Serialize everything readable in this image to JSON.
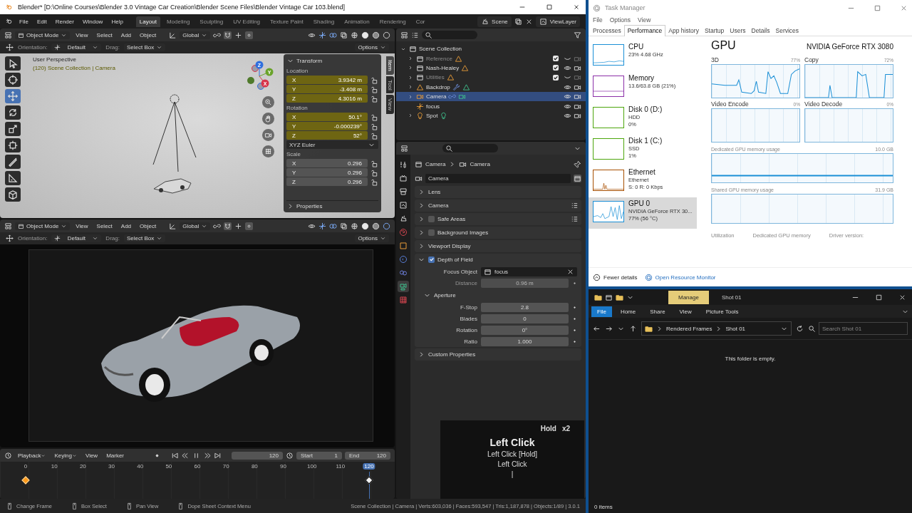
{
  "blender": {
    "title": "Blender* [D:\\Online Courses\\Blender 3.0 Vintage Car Creation\\Blender Scene Files\\Blender Vintage Car 103.blend]",
    "menus": [
      "File",
      "Edit",
      "Render",
      "Window",
      "Help"
    ],
    "workspaces": [
      {
        "label": "Layout",
        "selected": true
      },
      {
        "label": "Modeling",
        "selected": false
      },
      {
        "label": "Sculpting",
        "selected": false
      },
      {
        "label": "UV Editing",
        "selected": false
      },
      {
        "label": "Texture Paint",
        "selected": false
      },
      {
        "label": "Shading",
        "selected": false
      },
      {
        "label": "Animation",
        "selected": false
      },
      {
        "label": "Rendering",
        "selected": false
      },
      {
        "label": "Cor",
        "selected": false
      }
    ],
    "viewports": [
      {
        "kind": "solid",
        "header": {
          "mode": "Object Mode",
          "menus": [
            "View",
            "Select",
            "Add",
            "Object"
          ],
          "orientation": "Global"
        },
        "tool_header": {
          "orientation_label": "Orientation:",
          "orientation": "Default",
          "drag_label": "Drag:",
          "drag": "Select Box",
          "options": "Options"
        },
        "tools": [
          {
            "kind": "select",
            "selected": false
          },
          {
            "kind": "cursor",
            "selected": false
          },
          {
            "kind": "move",
            "selected": true
          },
          {
            "kind": "rotate",
            "selected": false
          },
          {
            "kind": "scale",
            "selected": false
          },
          {
            "kind": "transform",
            "selected": false
          },
          {
            "kind": "annotate",
            "selected": false
          },
          {
            "kind": "measure",
            "selected": false
          },
          {
            "kind": "add_cube",
            "selected": false
          }
        ],
        "overlay": {
          "perspective": "User Perspective",
          "collection": "(120) Scene Collection | Camera"
        },
        "axes": [
          {
            "label": "Z",
            "color": "#2f6fde"
          },
          {
            "label": "Y",
            "color": "#6aa32a"
          },
          {
            "label": "X",
            "color": "#d8344a"
          }
        ],
        "sidebar": {
          "tabs": [
            {
              "label": "Item",
              "selected": true
            },
            {
              "label": "Tool",
              "selected": false
            },
            {
              "label": "View",
              "selected": false
            }
          ],
          "panel": "Transform",
          "groups": [
            {
              "label": "Location",
              "fields": [
                {
                  "axis": "X",
                  "value": "3.9342 m",
                  "keyed": true
                },
                {
                  "axis": "Y",
                  "value": "-3.408 m",
                  "keyed": true
                },
                {
                  "axis": "Z",
                  "value": "4.3016 m",
                  "keyed": true
                }
              ]
            },
            {
              "label": "Rotation",
              "fields": [
                {
                  "axis": "X",
                  "value": "50.1°",
                  "keyed": true
                },
                {
                  "axis": "Y",
                  "value": "-0.000239°",
                  "keyed": true
                },
                {
                  "axis": "Z",
                  "value": "52°",
                  "keyed": true
                }
              ],
              "dropdown": "XYZ Euler"
            },
            {
              "label": "Scale",
              "fields": [
                {
                  "axis": "X",
                  "value": "0.296",
                  "keyed": false
                },
                {
                  "axis": "Y",
                  "value": "0.296",
                  "keyed": false
                },
                {
                  "axis": "Z",
                  "value": "0.296",
                  "keyed": false
                }
              ]
            }
          ],
          "collapsed_panel": "Properties"
        }
      },
      {
        "kind": "camera",
        "header": {
          "mode": "Object Mode",
          "menus": [
            "View",
            "Select",
            "Add",
            "Object"
          ],
          "orientation": "Global"
        },
        "tool_header": {
          "orientation_label": "Orientation:",
          "orientation": "Default",
          "drag_label": "Drag:",
          "drag": "Select Box",
          "options": "Options"
        }
      }
    ],
    "timeline": {
      "menus": [
        "Playback",
        "Keying",
        "View",
        "Marker"
      ],
      "frame": "120",
      "start_label": "Start",
      "start": "1",
      "end_label": "End",
      "end": "120",
      "ticks": [
        {
          "label": "0",
          "selected": false,
          "keyframe": true,
          "keyframe_selected": true
        },
        {
          "label": "10",
          "selected": false,
          "keyframe": false,
          "keyframe_selected": false
        },
        {
          "label": "20",
          "selected": false,
          "keyframe": false,
          "keyframe_selected": false
        },
        {
          "label": "30",
          "selected": false,
          "keyframe": false,
          "keyframe_selected": false
        },
        {
          "label": "40",
          "selected": false,
          "keyframe": false,
          "keyframe_selected": false
        },
        {
          "label": "50",
          "selected": false,
          "keyframe": false,
          "keyframe_selected": false
        },
        {
          "label": "60",
          "selected": false,
          "keyframe": false,
          "keyframe_selected": false
        },
        {
          "label": "70",
          "selected": false,
          "keyframe": false,
          "keyframe_selected": false
        },
        {
          "label": "80",
          "selected": false,
          "keyframe": false,
          "keyframe_selected": false
        },
        {
          "label": "90",
          "selected": false,
          "keyframe": false,
          "keyframe_selected": false
        },
        {
          "label": "100",
          "selected": false,
          "keyframe": false,
          "keyframe_selected": false
        },
        {
          "label": "110",
          "selected": false,
          "keyframe": false,
          "keyframe_selected": false
        },
        {
          "label": "120",
          "selected": true,
          "keyframe": true,
          "keyframe_selected": false
        }
      ]
    },
    "outliner": {
      "title": "Scene",
      "view_layer": "ViewLayer",
      "tree": [
        {
          "name": "Scene Collection",
          "kind": "scene_collection",
          "expanded": true,
          "children": [
            {
              "name": "Reference",
              "kind": "collection",
              "expanded": false,
              "checked": true,
              "visible": false,
              "selected": false
            },
            {
              "name": "Nash-Healey",
              "kind": "collection",
              "expanded": false,
              "checked": true,
              "visible": true,
              "selected": false
            },
            {
              "name": "Utilities",
              "kind": "collection",
              "expanded": false,
              "checked": true,
              "visible": false,
              "selected": false
            },
            {
              "name": "Backdrop",
              "kind": "mesh",
              "expanded": false,
              "visible": true,
              "selected": false
            },
            {
              "name": "Camera",
              "kind": "camera",
              "expanded": false,
              "visible": true,
              "selected": true
            },
            {
              "name": "focus",
              "kind": "empty",
              "visible": true,
              "selected": false
            },
            {
              "name": "Spot",
              "kind": "light",
              "expanded": false,
              "visible": true,
              "selected": false
            }
          ]
        }
      ]
    },
    "properties": {
      "tabs": [
        {
          "kind": "tool",
          "selected": false
        },
        {
          "kind": "render",
          "selected": false
        },
        {
          "kind": "output",
          "selected": false
        },
        {
          "kind": "view_layer",
          "selected": false
        },
        {
          "kind": "scene",
          "selected": false
        },
        {
          "kind": "world",
          "selected": false
        },
        {
          "kind": "object",
          "selected": false
        },
        {
          "kind": "physics",
          "selected": false
        },
        {
          "kind": "constraints",
          "selected": false
        },
        {
          "kind": "data",
          "selected": true
        },
        {
          "kind": "texture",
          "selected": false
        }
      ],
      "breadcrumb": [
        "Camera",
        "Camera"
      ],
      "datablock": "Camera",
      "panels": [
        {
          "kind": "panel",
          "label": "Lens",
          "expanded": false,
          "presets": false
        },
        {
          "kind": "panel",
          "label": "Camera",
          "expanded": false,
          "presets": true
        },
        {
          "kind": "toggle",
          "label": "Safe Areas",
          "checked": false,
          "expanded": false,
          "presets": true
        },
        {
          "kind": "toggle",
          "label": "Background Images",
          "checked": false,
          "expanded": false,
          "presets": false
        },
        {
          "kind": "panel",
          "label": "Viewport Display",
          "expanded": false,
          "presets": false
        },
        {
          "kind": "toggle",
          "label": "Depth of Field",
          "checked": true,
          "expanded": true,
          "presets": false,
          "fields": [
            {
              "kind": "object",
              "label": "Focus Object",
              "value": "focus",
              "disabled": false
            },
            {
              "kind": "number",
              "label": "Distance",
              "value": "0.96 m",
              "disabled": true
            }
          ],
          "subpanels": [
            {
              "label": "Aperture",
              "expanded": true,
              "fields": [
                {
                  "kind": "number",
                  "label": "F-Stop",
                  "value": "2.8",
                  "disabled": false
                },
                {
                  "kind": "number",
                  "label": "Blades",
                  "value": "0",
                  "disabled": false
                },
                {
                  "kind": "number",
                  "label": "Rotation",
                  "value": "0°",
                  "disabled": false
                },
                {
                  "kind": "number",
                  "label": "Ratio",
                  "value": "1.000",
                  "disabled": false
                }
              ]
            }
          ]
        },
        {
          "kind": "panel",
          "label": "Custom Properties",
          "expanded": false,
          "presets": false
        }
      ]
    },
    "keys_overlay": {
      "hold": "Hold",
      "count": "x2",
      "title": "Left Click",
      "lines": [
        "Left Click [Hold]",
        "Left Click",
        "|"
      ]
    },
    "status_bar": {
      "hints": [
        "Change Frame",
        "Box Select",
        "Pan View",
        "Dope Sheet Context Menu"
      ],
      "info": "Scene Collection | Camera | Verts:603,036 | Faces:593,547 | Tris:1,187,878 | Objects:1/89 | 3.0.1"
    }
  },
  "task_manager": {
    "title": "Task Manager",
    "menus": [
      "File",
      "Options",
      "View"
    ],
    "tabs": [
      {
        "label": "Processes",
        "selected": false
      },
      {
        "label": "Performance",
        "selected": true
      },
      {
        "label": "App history",
        "selected": false
      },
      {
        "label": "Startup",
        "selected": false
      },
      {
        "label": "Users",
        "selected": false
      },
      {
        "label": "Details",
        "selected": false
      },
      {
        "label": "Services",
        "selected": false
      }
    ],
    "resources": [
      {
        "name": "CPU",
        "lines": [
          "23% 4.68 GHz"
        ],
        "color": "#1a8fd6",
        "selected": false
      },
      {
        "name": "Memory",
        "lines": [
          "13.6/63.8 GB (21%)"
        ],
        "color": "#8b2fa8",
        "selected": false
      },
      {
        "name": "Disk 0 (D:)",
        "lines": [
          "HDD",
          "0%"
        ],
        "color": "#4da60c",
        "selected": false
      },
      {
        "name": "Disk 1 (C:)",
        "lines": [
          "SSD",
          "1%"
        ],
        "color": "#4da60c",
        "selected": false
      },
      {
        "name": "Ethernet",
        "lines": [
          "Ethernet",
          "S: 0 R: 0 Kbps"
        ],
        "color": "#a74f01",
        "selected": false
      },
      {
        "name": "GPU 0",
        "lines": [
          "NVIDIA GeForce RTX 30...",
          "77% (56 °C)"
        ],
        "color": "#1a8fd6",
        "selected": true
      }
    ],
    "heading": "GPU",
    "device": "NVIDIA GeForce RTX 3080",
    "engines": [
      {
        "label": "3D",
        "reading": "77%"
      },
      {
        "label": "Copy",
        "reading": "72%"
      },
      {
        "label": "Video Encode",
        "reading": "0%"
      },
      {
        "label": "Video Decode",
        "reading": "0%"
      }
    ],
    "memory_graphs": [
      {
        "label": "Dedicated GPU memory usage",
        "reading": "10.0 GB"
      },
      {
        "label": "Shared GPU memory usage",
        "reading": "31.9 GB"
      }
    ],
    "stats": [
      "Utilization",
      "Dedicated GPU memory",
      "Driver version:"
    ],
    "fewer_details": "Fewer details",
    "resource_monitor": "Open Resource Monitor"
  },
  "explorer": {
    "context_tab": "Manage",
    "title": "Shot 01",
    "ribbon_tabs": [
      {
        "label": "File",
        "selected": true
      },
      {
        "label": "Home",
        "selected": false
      },
      {
        "label": "Share",
        "selected": false
      },
      {
        "label": "View",
        "selected": false
      },
      {
        "label": "Picture Tools",
        "selected": false
      }
    ],
    "path": [
      "Rendered Frames",
      "Shot 01"
    ],
    "search": {
      "placeholder": "Search Shot 01"
    },
    "empty_message": "This folder is empty.",
    "status": "0 items"
  }
}
